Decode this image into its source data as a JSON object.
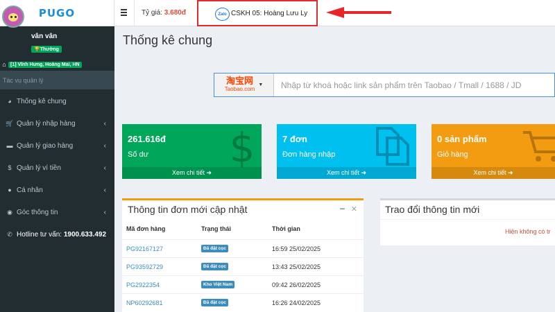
{
  "brand": {
    "logo": "PUGO"
  },
  "user": {
    "name": "vân vân",
    "level_badge": "Thường",
    "address": "[1] Vĩnh Hưng, Hoàng Mai, HN"
  },
  "sidebar": {
    "search_placeholder": "Tác vụ quản lý",
    "items": [
      {
        "label": "Thống kê chung",
        "icon": "dashboard-icon"
      },
      {
        "label": "Quản lý nhập hàng",
        "icon": "cart-icon"
      },
      {
        "label": "Quản lý giao hàng",
        "icon": "truck-icon"
      },
      {
        "label": "Quản lý ví tiền",
        "icon": "dollar-icon"
      },
      {
        "label": "Cá nhân",
        "icon": "user-icon"
      },
      {
        "label": "Góc thông tin",
        "icon": "chat-icon"
      }
    ],
    "hotline_label": "Hotline tư vấn:",
    "hotline_number": "1900.633.492"
  },
  "header": {
    "rate_label": "Tỷ giá:",
    "rate_value": "3.680đ",
    "zalo_text": "Zalo",
    "support_label": "CSKH 05: Hoàng Lưu Ly"
  },
  "main": {
    "title": "Thống kê chung",
    "search": {
      "site_cn": "淘宝网",
      "site_en": "Taobao.com",
      "placeholder": "Nhập từ khoá hoặc link sản phẩm trên Taobao / Tmall / 1688 / JD"
    },
    "stats": [
      {
        "value": "261.616đ",
        "label": "Số dư",
        "link": "Xem chi tiết",
        "color": "#00a65a"
      },
      {
        "value": "7 đơn",
        "label": "Đơn hàng nhập",
        "link": "Xem chi tiết",
        "color": "#00c0ef"
      },
      {
        "value": "0 sản phẩm",
        "label": "Giỏ hàng",
        "link": "Xem chi tiết",
        "color": "#f39c12"
      }
    ],
    "orders_panel": {
      "title": "Thông tin đơn mới cập nhật",
      "columns": [
        "Mã đơn hàng",
        "Trạng thái",
        "Thời gian"
      ],
      "rows": [
        {
          "code": "PG92167127",
          "status": "Đã đặt cọc",
          "time": "16:59 25/02/2025"
        },
        {
          "code": "PG93592729",
          "status": "Đã đặt cọc",
          "time": "13:43 25/02/2025"
        },
        {
          "code": "PG2922354",
          "status": "Kho Việt Nam",
          "time": "09:42 26/02/2025"
        },
        {
          "code": "NP60292681",
          "status": "Đã đặt cọc",
          "time": "16:26 24/02/2025"
        }
      ]
    },
    "chat_panel": {
      "title": "Trao đổi thông tin mới",
      "empty_text": "Hiện không có tr"
    }
  },
  "colors": {
    "sidebar_bg": "#222d32",
    "accent_blue": "#3c8dbc",
    "highlight_red": "#e12a2a"
  }
}
